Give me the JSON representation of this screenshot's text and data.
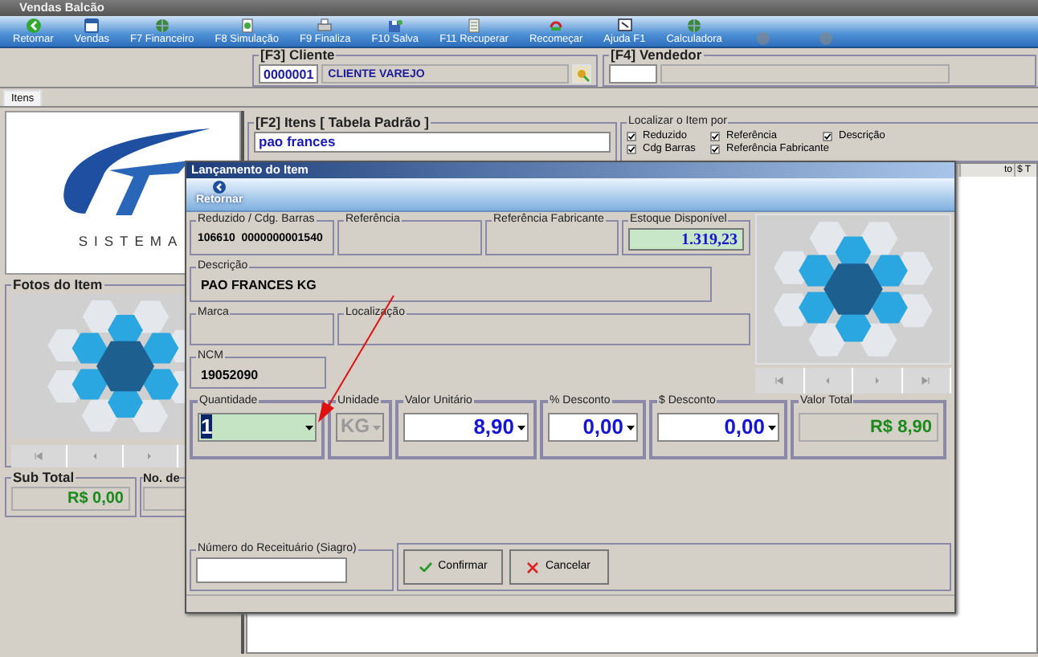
{
  "window": {
    "title": "Vendas Balcão"
  },
  "toolbar": [
    {
      "label": "Retornar",
      "disabled": false
    },
    {
      "label": "Vendas",
      "disabled": false
    },
    {
      "label": "F7 Financeiro",
      "disabled": false
    },
    {
      "label": "F8 Simulação",
      "disabled": false
    },
    {
      "label": "F9 Finaliza",
      "disabled": false
    },
    {
      "label": "F10 Salva",
      "disabled": false
    },
    {
      "label": "F11 Recuperar",
      "disabled": false
    },
    {
      "label": "Recomeçar",
      "disabled": false
    },
    {
      "label": "Ajuda F1",
      "disabled": false
    },
    {
      "label": "Calculadora",
      "disabled": false
    },
    {
      "disabled": true
    },
    {
      "disabled": true
    }
  ],
  "cliente": {
    "label": "[F3] Cliente",
    "code": "0000001",
    "name": "CLIENTE VAREJO"
  },
  "vendedor": {
    "label": "[F4] Vendedor"
  },
  "tabs": [
    {
      "label": "Itens",
      "selected": true
    }
  ],
  "logo": {
    "text": "SISTEMA"
  },
  "fotos": {
    "title": "Fotos do Item"
  },
  "subtotal": {
    "label": "Sub Total",
    "value": "R$ 0,00"
  },
  "no_de": {
    "label": "No. de"
  },
  "item_search": {
    "label": "[F2] Itens [ Tabela Padrão ]",
    "value": "pao frances"
  },
  "localizar": {
    "label": "Localizar o Item por",
    "options": [
      {
        "label": "Reduzido",
        "checked": true
      },
      {
        "label": "Referência",
        "checked": true
      },
      {
        "label": "Descrição",
        "checked": true
      },
      {
        "label": "Cdg Barras",
        "checked": true
      },
      {
        "label": "Referência Fabricante",
        "checked": true
      }
    ]
  },
  "table": {
    "columns": [
      "to",
      "$ T"
    ]
  },
  "dialog": {
    "title": "Lançamento do Item",
    "back": "Retornar",
    "reduzido": {
      "label": "Reduzido / Cdg. Barras",
      "value": "106610  0000000001540"
    },
    "referencia": {
      "label": "Referência"
    },
    "referencia_fabricante": {
      "label": "Referência Fabricante"
    },
    "estoque": {
      "label": "Estoque Disponível",
      "value": "1.319,23"
    },
    "descricao": {
      "label": "Descrição",
      "value": "PAO FRANCES KG"
    },
    "marca": {
      "label": "Marca"
    },
    "localizacao": {
      "label": "Localização"
    },
    "ncm": {
      "label": "NCM",
      "value": "19052090"
    },
    "entry": [
      {
        "label": "Quantidade",
        "value": "1",
        "kind": "combo",
        "focused": true,
        "disabled": false
      },
      {
        "label": "Unidade",
        "value": "KG",
        "kind": "combo",
        "focused": false,
        "disabled": true
      },
      {
        "label": "Valor Unitário",
        "value": "8,90",
        "kind": "combo",
        "focused": false,
        "disabled": false
      },
      {
        "label": "% Desconto",
        "value": "0,00",
        "kind": "combo",
        "focused": false,
        "disabled": false
      },
      {
        "label": "$ Desconto",
        "value": "0,00",
        "kind": "combo",
        "focused": false,
        "disabled": false
      },
      {
        "label": "Valor Total",
        "value": "R$ 8,90",
        "kind": "total"
      }
    ],
    "receituario": {
      "label": "Número do Receituário (Siagro)"
    },
    "buttons": [
      {
        "label": "Confirmar",
        "kind": "confirm"
      },
      {
        "label": "Cancelar",
        "kind": "cancel"
      }
    ]
  }
}
